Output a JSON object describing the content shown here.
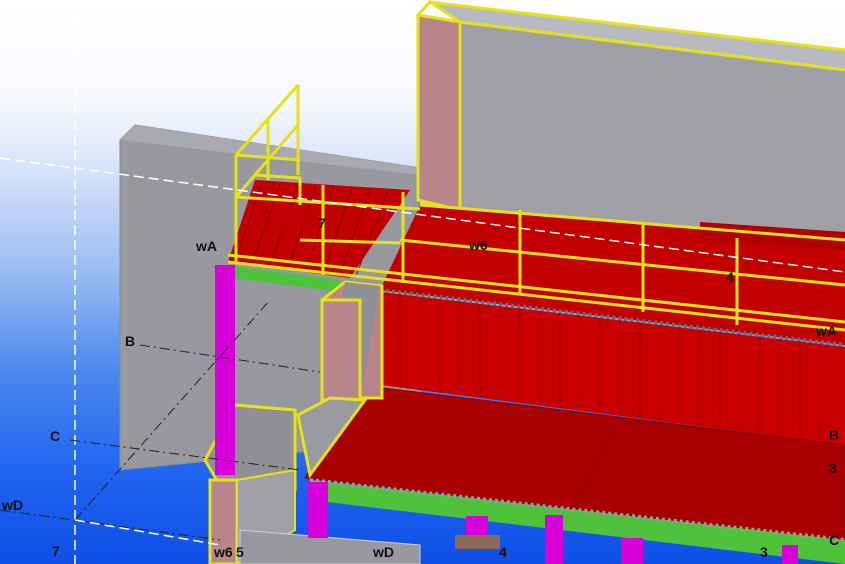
{
  "grid_labels": {
    "wA_top": "wA",
    "w6_upper": "w6",
    "seven_upper": "7",
    "four_upper": "4",
    "wA_right": "wA",
    "B_left": "B",
    "C_left": "C",
    "wD_left": "wD",
    "seven_lower": "7",
    "w6_lower": "w6",
    "five_lower": "5",
    "wD_lower": "wD",
    "four_lower": "4",
    "three_lower": "3",
    "B_right": "B",
    "three_right": "3",
    "C_right": "C"
  },
  "colors": {
    "concrete": "#999aa0",
    "concrete_dark": "#7f8086",
    "wall_edge": "#d9d9d9",
    "grating_red": "#c20000",
    "grating_dark": "#8e0000",
    "railing_yellow": "#e6e21a",
    "beam_green": "#4ec23a",
    "column_magenta": "#d800d8",
    "pink_wall": "#b8868a"
  }
}
